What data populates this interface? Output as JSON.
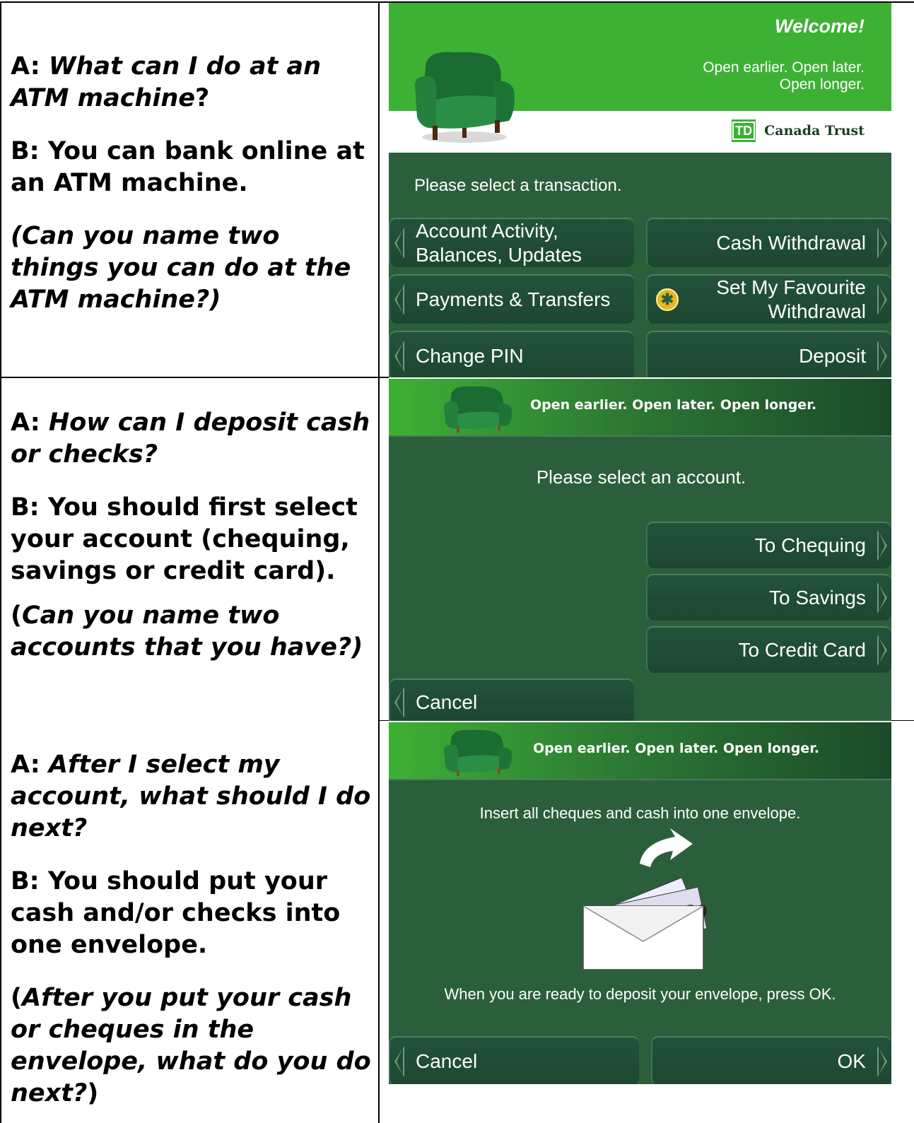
{
  "rows": [
    {
      "a_prefix": "A: ",
      "a_question": "What can I do at an ATM machine",
      "a_suffix": "?",
      "b_answer": "B: You can bank online at an ATM machine.",
      "prompt": "(Can you name two things you can do at the ATM machine?)"
    },
    {
      "a_prefix": "A: ",
      "a_question": "How can I deposit cash or checks?",
      "b_answer": "B: You should first select your account (chequing, savings or credit card).",
      "prompt_open": "(",
      "prompt": "Can you name two accounts that you have?)"
    },
    {
      "a_prefix": "A: ",
      "a_question": "After I select my account, what should I do next?",
      "b_answer": "B: You should put your cash and/or checks into one envelope.",
      "prompt_open": "(",
      "prompt": "After you put your cash or cheques in the envelope, what do you do next?",
      "prompt_close": ")"
    }
  ],
  "screen1": {
    "welcome": "Welcome!",
    "tagline_line1": "Open earlier.  Open later.",
    "tagline_line2": "Open longer.",
    "logo_text": "TD",
    "bank_name": "Canada Trust",
    "prompt": "Please select a transaction.",
    "buttons": {
      "account_activity_1": "Account Activity,",
      "account_activity_2": "Balances, Updates",
      "cash_withdrawal": "Cash Withdrawal",
      "payments_transfers": "Payments & Transfers",
      "favourite_1": "Set My Favourite",
      "favourite_2": "Withdrawal",
      "change_pin": "Change PIN",
      "deposit": "Deposit"
    }
  },
  "screen2": {
    "banner": "Open earlier. Open later. Open longer.",
    "prompt": "Please select an account.",
    "buttons": {
      "to_chequing": "To Chequing",
      "to_savings": "To Savings",
      "to_credit_card": "To Credit Card",
      "cancel": "Cancel"
    }
  },
  "screen3": {
    "banner": "Open earlier. Open later. Open longer.",
    "instruction": "Insert all cheques and cash into one envelope.",
    "ready": "When you are ready to deposit your envelope, press OK.",
    "buttons": {
      "cancel": "Cancel",
      "ok": "OK"
    }
  },
  "colors": {
    "atm_bg": "#2b5f3c",
    "brand_green": "#3db134",
    "button": "#1f4b33",
    "text": "#000000"
  }
}
